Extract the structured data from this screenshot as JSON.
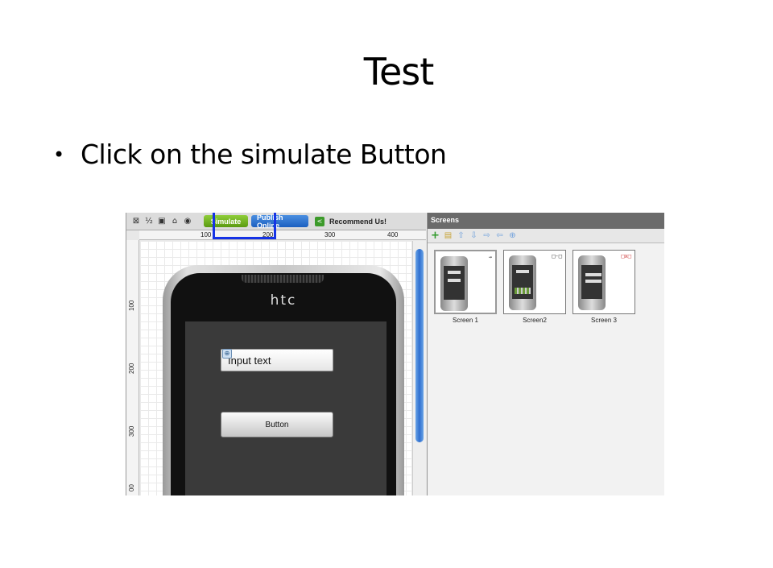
{
  "slide": {
    "title": "Test",
    "bullet": "Click on the simulate Button"
  },
  "screenshot": {
    "toolbar": {
      "simulate_label": "Simulate",
      "publish_label": "Publish Online",
      "recommend_label": "Recommend Us!",
      "highlight_color": "#1533e6"
    },
    "ruler_top": [
      "100",
      "200",
      "300",
      "400"
    ],
    "ruler_left": [
      "100",
      "200",
      "300",
      "00"
    ],
    "phone": {
      "brand": "htc",
      "input_text": "Input text",
      "button_label": "Button"
    },
    "screens_panel": {
      "header": "Screens",
      "thumbnails": [
        {
          "label": "Screen 1",
          "mark": "→"
        },
        {
          "label": "Screen2",
          "mark": "□-□"
        },
        {
          "label": "Screen 3",
          "mark": "□x□"
        }
      ]
    }
  }
}
